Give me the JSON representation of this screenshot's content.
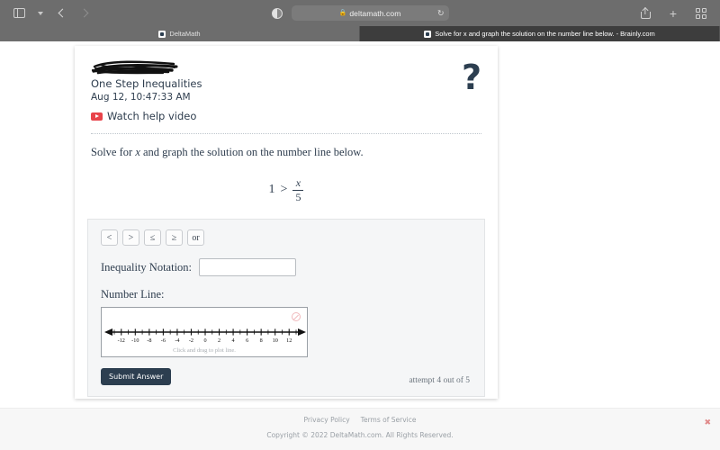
{
  "browser": {
    "back_icon": "chevron-left-icon",
    "forward_icon": "chevron-right-icon",
    "sidebar_icon": "sidebar-toggle-icon",
    "dropdown_icon": "chevron-down-icon",
    "privacy_icon": "privacy-shield-icon",
    "share_icon": "share-icon",
    "newtab_icon": "plus-icon",
    "tab_overview_icon": "tab-grid-icon",
    "address": {
      "lock": "🔒",
      "host": "deltamath.com",
      "reload_icon": "↻"
    },
    "tabs": [
      {
        "label": "DeltaMath",
        "active": false
      },
      {
        "label": "Solve for x and graph the solution on the number line below. - Brainly.com",
        "active": true
      }
    ]
  },
  "assignment": {
    "student_name_redacted": "",
    "title": "One Step Inequalities",
    "timestamp": "Aug 12, 10:47:33 AM",
    "help_video_label": "Watch help video",
    "help_icon": "question-mark-icon"
  },
  "problem": {
    "prompt_before": "Solve for ",
    "prompt_variable": "x",
    "prompt_after": " and graph the solution on the number line below.",
    "equation": {
      "left": "1",
      "relation": ">",
      "numerator": "x",
      "denominator": "5"
    }
  },
  "answer": {
    "operator_buttons": [
      "<",
      ">",
      "≤",
      "≥",
      "or"
    ],
    "inequality_label": "Inequality Notation:",
    "inequality_value": "",
    "inequality_placeholder": "",
    "numberline_label": "Number Line:",
    "numberline_hint": "Click and drag to plot line.",
    "clear_icon": "no-entry-clear-icon",
    "submit_label": "Submit Answer",
    "attempt_text": "attempt 4 out of 5"
  },
  "numberline": {
    "min": -13,
    "max": 13,
    "major_ticks": [
      -12,
      -10,
      -8,
      -6,
      -4,
      -2,
      0,
      2,
      4,
      6,
      8,
      10,
      12
    ],
    "minor_ticks": [
      -13,
      -11,
      -9,
      -7,
      -5,
      -3,
      -1,
      1,
      3,
      5,
      7,
      9,
      11,
      13
    ],
    "labels": [
      "-12",
      "-10",
      "-8",
      "-6",
      "-4",
      "-2",
      "0",
      "2",
      "4",
      "6",
      "8",
      "10",
      "12"
    ]
  },
  "footer": {
    "privacy_label": "Privacy Policy",
    "terms_label": "Terms of Service",
    "copyright": "Copyright © 2022 DeltaMath.com. All Rights Reserved.",
    "close_icon": "✖"
  },
  "colors": {
    "brand_dark": "#2c3e50",
    "youtube_red": "#e8434a",
    "panel_bg": "#f5f6f7",
    "muted_text": "#9aa0a6",
    "close_red": "#e08a8a"
  }
}
